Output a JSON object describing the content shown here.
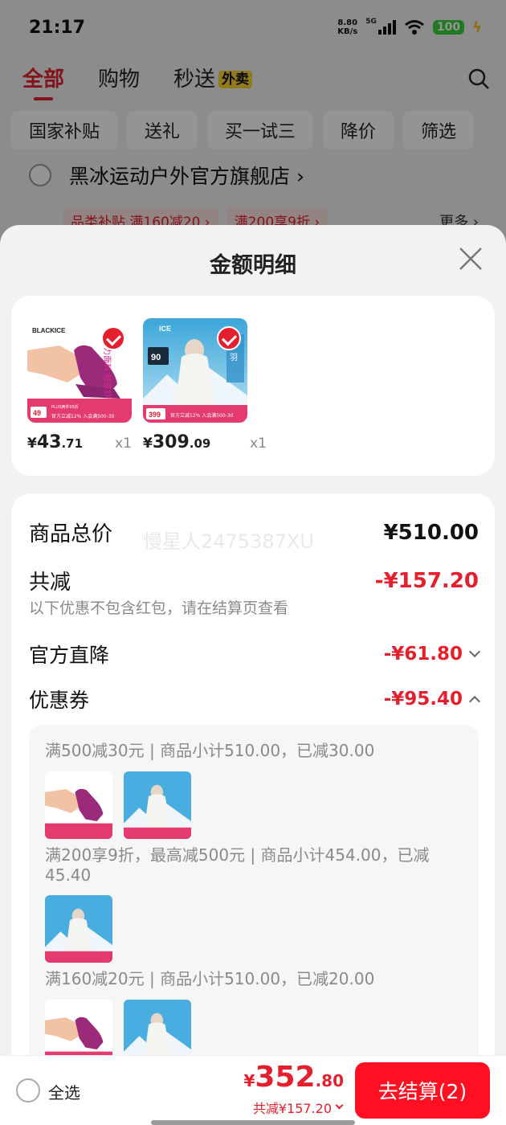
{
  "status_bar": {
    "time": "21:17",
    "net_speed_value": "8.80",
    "net_speed_unit": "KB/s",
    "network": "5G",
    "battery": "100"
  },
  "top_tabs": [
    {
      "label": "全部",
      "active": true
    },
    {
      "label": "购物",
      "active": false
    },
    {
      "label": "秒送",
      "active": false,
      "badge": "外卖"
    }
  ],
  "filters": [
    "国家补贴",
    "送礼",
    "买一试三",
    "降价",
    "筛选"
  ],
  "store": {
    "name": "黑冰运动户外官方旗舰店",
    "promos": [
      "品类补贴 满160减20",
      "满200享9折"
    ],
    "more": "更多"
  },
  "sheet": {
    "title": "金额明细",
    "products": [
      {
        "brand": "BLACKICE",
        "price_symbol": "¥",
        "price_int": "43",
        "price_dec": ".71",
        "qty": "x1",
        "badge_price": "49"
      },
      {
        "brand": "ICE",
        "price_symbol": "¥",
        "price_int": "309",
        "price_dec": ".09",
        "qty": "x1",
        "badge_price": "399"
      }
    ],
    "watermark": "慢星人2475387XU",
    "rows": {
      "total_label": "商品总价",
      "total_value": "¥510.00",
      "discount_label": "共减",
      "discount_value": "-¥157.20",
      "note": "以下优惠不包含红包，请在结算页查看",
      "official_label": "官方直降",
      "official_value": "-¥61.80",
      "coupon_label": "优惠券",
      "coupon_value": "-¥95.40"
    },
    "coupons": [
      {
        "text": "满500减30元 | 商品小计510.00，已减30.00"
      },
      {
        "text": "满200享9折，最高减500元 | 商品小计454.00，已减45.40"
      },
      {
        "text": "满160减20元 | 商品小计510.00，已减20.00"
      }
    ]
  },
  "bottom_bar": {
    "select_all": "全选",
    "total_symbol": "¥",
    "total_int": "352",
    "total_dec": ".80",
    "saved": "共减¥157.20",
    "checkout": "去结算(2)"
  }
}
